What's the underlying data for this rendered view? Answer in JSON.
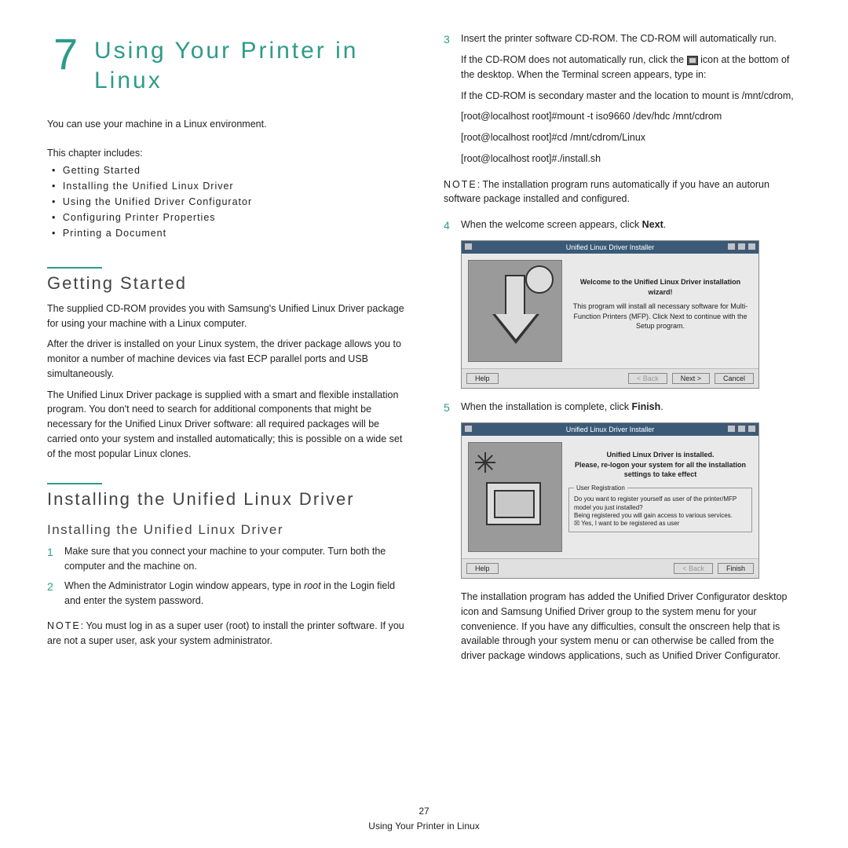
{
  "chapter": {
    "number": "7",
    "title": "Using Your Printer in Linux"
  },
  "intro": "You can use your machine in a Linux environment.",
  "includes_label": "This chapter includes:",
  "toc": [
    "Getting Started",
    "Installing the Unified Linux Driver",
    "Using the Unified Driver Configurator",
    "Configuring Printer Properties",
    "Printing a Document"
  ],
  "s1": {
    "title": "Getting Started",
    "p1": "The supplied CD-ROM provides you with Samsung's Unified Linux Driver package for using your machine with a Linux computer.",
    "p2": "After the driver is installed on your Linux system, the driver package allows you to monitor a number of machine devices via fast ECP parallel ports and USB simultaneously.",
    "p3": "The Unified Linux Driver package is supplied with a smart and flexible installation program. You don't need to search for additional components that might be necessary for the Unified Linux Driver software: all required packages will be carried onto your system and installed automatically; this is possible on a wide set of the most popular Linux clones."
  },
  "s2": {
    "title": "Installing the Unified Linux Driver",
    "subtitle": "Installing the Unified Linux Driver",
    "step1": "Make sure that you connect your machine to your computer. Turn both the computer and the machine on.",
    "step2_a": "When the Administrator Login window appears, type in ",
    "step2_i": "root",
    "step2_b": " in the Login field and enter the system password.",
    "note1_label": "NOTE",
    "note1": ": You must log in as a super user (root) to install the printer software. If you are not a super user, ask your system administrator."
  },
  "right": {
    "step3": "Insert the printer software CD-ROM. The CD-ROM will automatically run.",
    "r1a": "If the CD-ROM does not automatically run, click the ",
    "r1b": " icon at the bottom of the desktop. When the Terminal screen appears, type in:",
    "r2": "If the CD-ROM is secondary master and the location to mount is /mnt/cdrom,",
    "cmd1": "[root@localhost root]#mount -t iso9660 /dev/hdc /mnt/cdrom",
    "cmd2": "[root@localhost root]#cd /mnt/cdrom/Linux",
    "cmd3": "[root@localhost root]#./install.sh",
    "note2_label": "NOTE",
    "note2": ": The installation program runs automatically if you have an autorun software package installed and configured.",
    "step4_a": "When the welcome screen appears, click ",
    "step4_b": "Next",
    "step4_c": ".",
    "step5_a": "When the installation is complete, click ",
    "step5_b": "Finish",
    "step5_c": ".",
    "tail": "The installation program has added the Unified Driver Configurator desktop icon and Samsung Unified Driver group to the system menu for your convenience. If you have any difficulties, consult the onscreen help that is available through your system menu or can otherwise be called from the driver package windows applications, such as Unified Driver Configurator."
  },
  "dlg": {
    "title": "Unified Linux Driver Installer",
    "welcome_b": "Welcome to the Unified Linux Driver installation wizard!",
    "welcome_p": "This program will install all necessary software for Multi-Function Printers (MFP). Click Next to continue with the Setup program.",
    "help": "Help",
    "back": "< Back",
    "next": "Next >",
    "cancel": "Cancel",
    "finish_b": "Unified Linux Driver is installed.\nPlease, re-logon your system for all the installation settings to take effect",
    "reg_legend": "User Registration",
    "reg_q": "Do you want to register yourself as user of the printer/MFP model you just installed?",
    "reg_line2": "Being registered you will gain access to various services.",
    "reg_chk": "Yes, I want to be registered as user",
    "finish": "Finish"
  },
  "footer": {
    "page": "27",
    "section": "Using Your Printer in Linux"
  }
}
